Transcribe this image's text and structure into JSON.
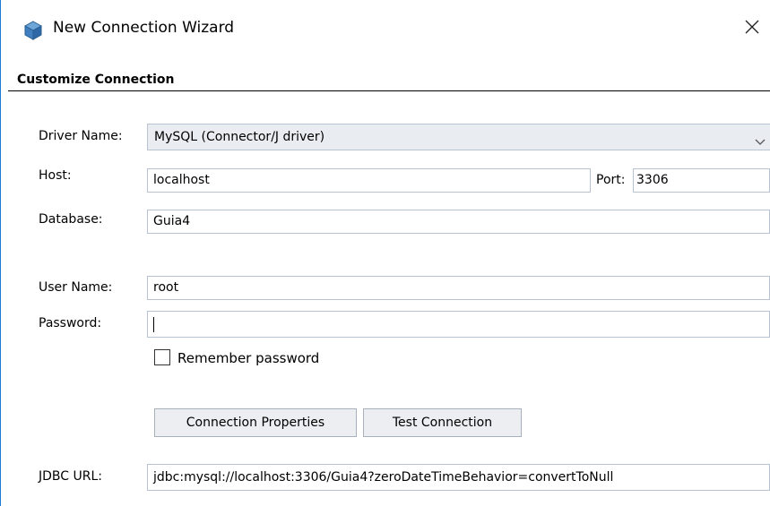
{
  "window": {
    "title": "New Connection Wizard",
    "icon": "database-cube-icon",
    "close_glyph": "✕"
  },
  "section": {
    "title": "Customize Connection"
  },
  "form": {
    "driver": {
      "label": "Driver Name:",
      "value": "MySQL (Connector/J driver)"
    },
    "host": {
      "label": "Host:",
      "value": "localhost"
    },
    "port": {
      "label": "Port:",
      "value": "3306"
    },
    "database": {
      "label": "Database:",
      "value": "Guia4"
    },
    "username": {
      "label": "User Name:",
      "value": "root"
    },
    "password": {
      "label": "Password:",
      "value": ""
    },
    "remember": {
      "label": "Remember password",
      "checked": false
    },
    "buttons": {
      "connection_properties": "Connection Properties",
      "test_connection": "Test Connection"
    },
    "jdbc": {
      "label": "JDBC URL:",
      "value": "jdbc:mysql://localhost:3306/Guia4?zeroDateTimeBehavior=convertToNull"
    }
  },
  "colors": {
    "field_border": "#b7c3d2",
    "select_bg": "#e9edf2",
    "button_bg": "#eceef1",
    "window_accent": "#1e7ad6"
  }
}
